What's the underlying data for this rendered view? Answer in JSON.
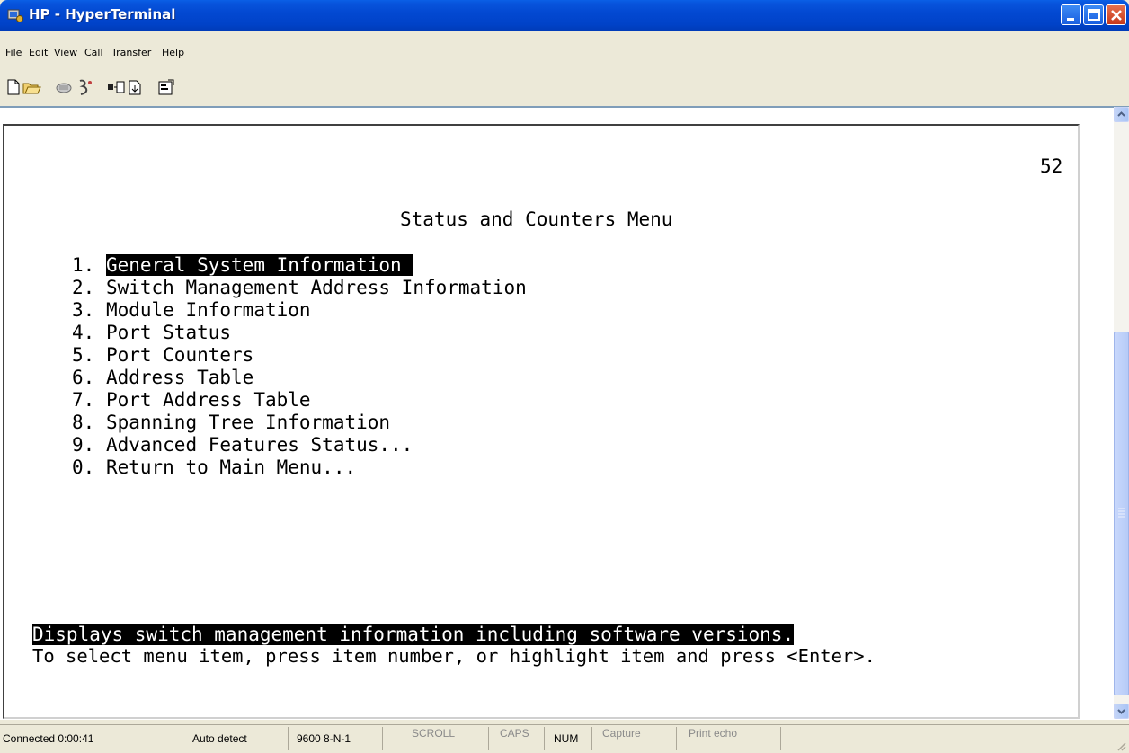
{
  "window": {
    "title": "HP - HyperTerminal"
  },
  "menu": {
    "file": "File",
    "edit": "Edit",
    "view": "View",
    "call": "Call",
    "transfer": "Transfer",
    "help": "Help"
  },
  "toolbar": {
    "icons": [
      "new-connection-icon",
      "open-icon",
      "disconnect-icon",
      "dial-icon",
      "send-icon",
      "receive-icon",
      "properties-icon"
    ]
  },
  "terminal": {
    "page_number": "52",
    "menu_title": "Status and Counters Menu",
    "items": [
      {
        "num": "1.",
        "label": "General System Information "
      },
      {
        "num": "2.",
        "label": "Switch Management Address Information"
      },
      {
        "num": "3.",
        "label": "Module Information"
      },
      {
        "num": "4.",
        "label": "Port Status"
      },
      {
        "num": "5.",
        "label": "Port Counters"
      },
      {
        "num": "6.",
        "label": "Address Table"
      },
      {
        "num": "7.",
        "label": "Port Address Table"
      },
      {
        "num": "8.",
        "label": "Spanning Tree Information"
      },
      {
        "num": "9.",
        "label": "Advanced Features Status..."
      },
      {
        "num": "0.",
        "label": "Return to Main Menu..."
      }
    ],
    "selected_index": 0,
    "description": "Displays switch management information including software versions.",
    "help": "To select menu item, press item number, or highlight item and press <Enter>."
  },
  "status": {
    "connected": "Connected 0:00:41",
    "detect": "Auto detect",
    "settings": "9600 8-N-1",
    "scroll": "SCROLL",
    "caps": "CAPS",
    "num": "NUM",
    "capture": "Capture",
    "print_echo": "Print echo"
  }
}
